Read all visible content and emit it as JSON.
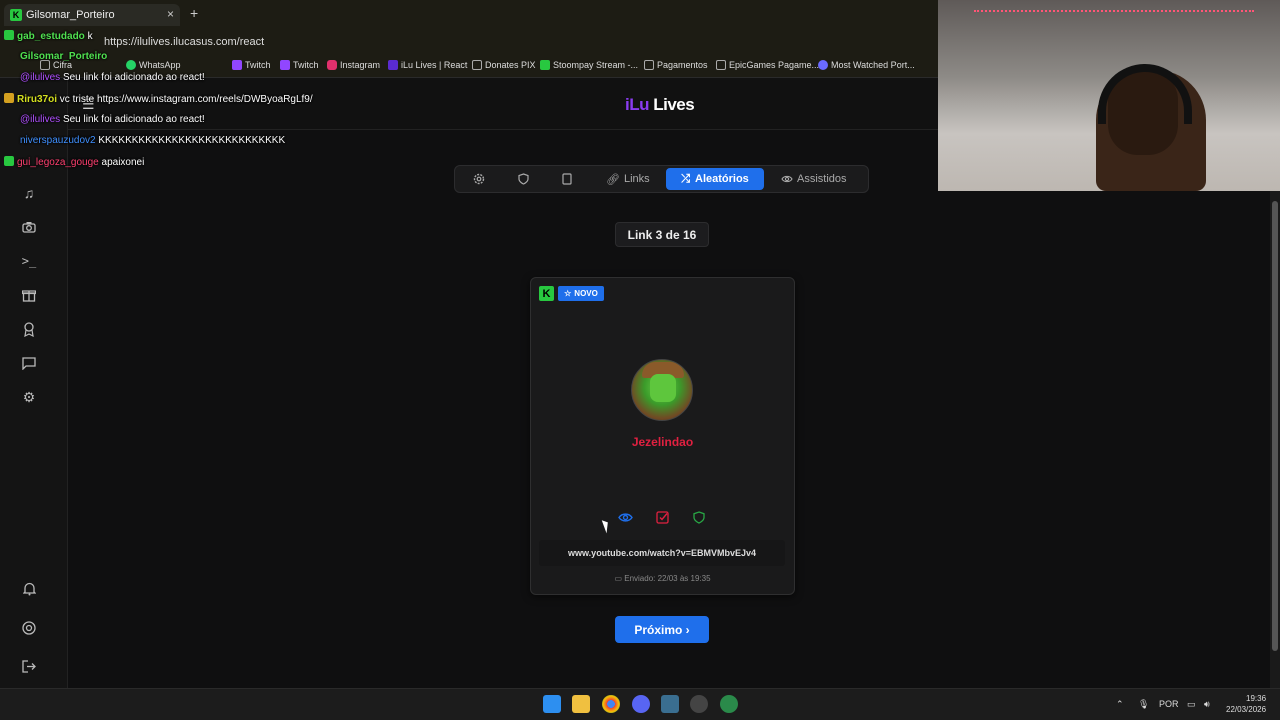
{
  "browser": {
    "tab_title": "Gilsomar_Porteiro",
    "url": "https://ilulives.ilucasus.com/react",
    "bookmarks": [
      "Cifra",
      "WhatsApp",
      "Twitch",
      "Twitch",
      "Instagram",
      "iLu Lives | React",
      "Donates PIX",
      "Stoompay Stream -...",
      "Pagamentos",
      "EpicGames Pagame...",
      "Most Watched Port..."
    ]
  },
  "header": {
    "logo_prefix": "iLu",
    "logo_suffix": " Lives"
  },
  "toolbar": {
    "links_label": "Links",
    "random_label": "Aleatórios",
    "watched_label": "Assistidos"
  },
  "counter": "Link 3 de 16",
  "card": {
    "badge_k": "K",
    "new_label": "NOVO",
    "username": "Jezelindao",
    "url": "www.youtube.com/watch?v=EBMVMbvEJv4",
    "sent": "Enviado: 22/03 às 19:35"
  },
  "next_button": "Próximo ›",
  "chat": [
    {
      "user": "gab_estudado",
      "color": "#50e050",
      "text": " k",
      "badge": true
    },
    {
      "user": "Gilsomar_Porteiro",
      "color": "#50e050",
      "text": "",
      "badge": false
    },
    {
      "user": "@ilulives",
      "color": "#b050ff",
      "text": " Seu link foi adicionado ao react!",
      "badge": false
    },
    {
      "user": "Riru37oi",
      "color": "#d4e020",
      "text": " vc triste https://www.instagram.com/reels/DWByoaRgLf9/",
      "badge": true
    },
    {
      "user": "@ilulives",
      "color": "#b050ff",
      "text": " Seu link foi adicionado ao react!",
      "badge": false
    },
    {
      "user": "niverspauzudov2",
      "color": "#4090ff",
      "text": " KKKKKKKKKKKKKKKKKKKKKKKKKKKK",
      "badge": false
    },
    {
      "user": "gui_legoza_gouge",
      "color": "#ff4070",
      "text": " apaixonei",
      "badge": true
    }
  ],
  "taskbar": {
    "lang": "POR",
    "time": "19:36",
    "date": "22/03/2026"
  }
}
